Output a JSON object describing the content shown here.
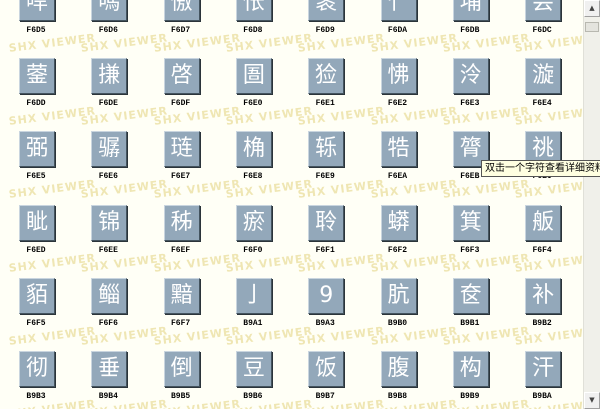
{
  "watermark": "SHX VIEWER",
  "tooltip": "双击一个字符查看详细资料",
  "rows": [
    [
      {
        "char": "哻",
        "code": "F6D5"
      },
      {
        "char": "嗎",
        "code": "F6D6"
      },
      {
        "char": "慠",
        "code": "F6D7"
      },
      {
        "char": "怅",
        "code": "F6D8"
      },
      {
        "char": "袠",
        "code": "F6D9"
      },
      {
        "char": "忄",
        "code": "F6DA"
      },
      {
        "char": "埔",
        "code": "F6DB"
      },
      {
        "char": "尝",
        "code": "F6DC"
      }
    ],
    [
      {
        "char": "蓥",
        "code": "F6DD"
      },
      {
        "char": "搛",
        "code": "F6DE"
      },
      {
        "char": "啓",
        "code": "F6DF"
      },
      {
        "char": "圄",
        "code": "F6E0"
      },
      {
        "char": "猃",
        "code": "F6E1"
      },
      {
        "char": "怫",
        "code": "F6E2"
      },
      {
        "char": "泠",
        "code": "F6E3"
      },
      {
        "char": "漩",
        "code": "F6E4"
      }
    ],
    [
      {
        "char": "弼",
        "code": "F6E5"
      },
      {
        "char": "骣",
        "code": "F6E6"
      },
      {
        "char": "琏",
        "code": "F6E7"
      },
      {
        "char": "桷",
        "code": "F6E8"
      },
      {
        "char": "轹",
        "code": "F6E9"
      },
      {
        "char": "牿",
        "code": "F6EA"
      },
      {
        "char": "膂",
        "code": "F6EB"
      },
      {
        "char": "祧",
        "code": "F6EC"
      }
    ],
    [
      {
        "char": "眦",
        "code": "F6ED"
      },
      {
        "char": "锦",
        "code": "F6EE"
      },
      {
        "char": "秭",
        "code": "F6EF"
      },
      {
        "char": "瘀",
        "code": "F6F0"
      },
      {
        "char": "聆",
        "code": "F6F1"
      },
      {
        "char": "蟒",
        "code": "F6F2"
      },
      {
        "char": "箕",
        "code": "F6F3"
      },
      {
        "char": "舨",
        "code": "F6F4"
      }
    ],
    [
      {
        "char": "貊",
        "code": "F6F5"
      },
      {
        "char": "鲻",
        "code": "F6F6"
      },
      {
        "char": "黯",
        "code": "F6F7"
      },
      {
        "char": "亅",
        "code": "B9A1"
      },
      {
        "char": "9",
        "code": "B9A3"
      },
      {
        "char": "肮",
        "code": "B9B0"
      },
      {
        "char": "奁",
        "code": "B9B1"
      },
      {
        "char": "补",
        "code": "B9B2"
      }
    ],
    [
      {
        "char": "彻",
        "code": "B9B3"
      },
      {
        "char": "垂",
        "code": "B9B4"
      },
      {
        "char": "倒",
        "code": "B9B5"
      },
      {
        "char": "豆",
        "code": "B9B6"
      },
      {
        "char": "饭",
        "code": "B9B7"
      },
      {
        "char": "腹",
        "code": "B9B8"
      },
      {
        "char": "构",
        "code": "B9B9"
      },
      {
        "char": "汗",
        "code": "B9BA"
      }
    ]
  ]
}
